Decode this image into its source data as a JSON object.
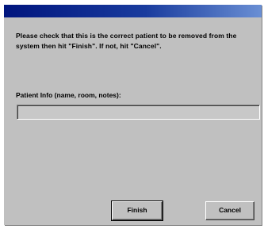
{
  "dialog": {
    "message": "Please check that this is the correct patient to be removed from the system then hit \"Finish\". If not, hit \"Cancel\".",
    "patient_info_label": "Patient Info (name, room, notes):",
    "patient_info_value": "",
    "finish_label": "Finish",
    "cancel_label": "Cancel"
  },
  "colors": {
    "titlebar": "#00157e",
    "dialog_background": "#c0c0c0"
  }
}
